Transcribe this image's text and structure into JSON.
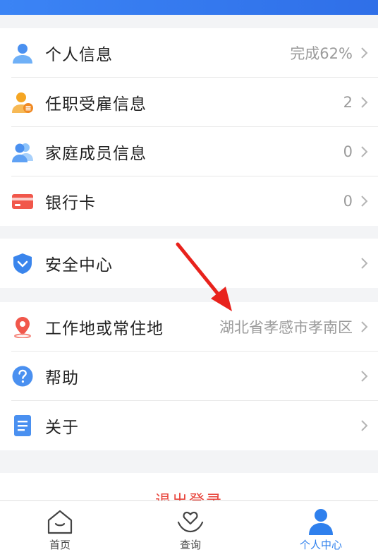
{
  "colors": {
    "accent": "#2f80ed",
    "logout": "#e8453c",
    "annotation_arrow": "#e8221c"
  },
  "menu_group1": [
    {
      "label": "个人信息",
      "value": "完成62%",
      "icon": "person-icon"
    },
    {
      "label": "任职受雇信息",
      "value": "2",
      "icon": "employee-icon"
    },
    {
      "label": "家庭成员信息",
      "value": "0",
      "icon": "family-icon"
    },
    {
      "label": "银行卡",
      "value": "0",
      "icon": "bank-card-icon"
    }
  ],
  "menu_group2": [
    {
      "label": "安全中心",
      "icon": "shield-icon"
    }
  ],
  "menu_group3": [
    {
      "label": "工作地或常住地",
      "value": "湖北省孝感市孝南区",
      "icon": "location-pin-icon"
    },
    {
      "label": "帮助",
      "icon": "help-icon"
    },
    {
      "label": "关于",
      "icon": "document-icon"
    }
  ],
  "logout_label": "退出登录",
  "tabs": [
    {
      "label": "首页",
      "icon": "home-icon",
      "active": false
    },
    {
      "label": "查询",
      "icon": "heart-hand-icon",
      "active": false
    },
    {
      "label": "个人中心",
      "icon": "user-profile-icon",
      "active": true
    }
  ]
}
